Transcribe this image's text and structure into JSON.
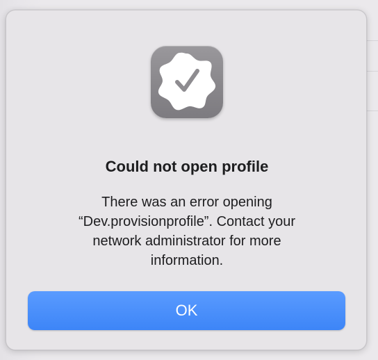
{
  "dialog": {
    "icon": "verified-badge-checkmark-icon",
    "title": "Could not open profile",
    "message": "There was an error opening “Dev.provisionprofile”. Contact your network administrator for more information.",
    "ok_label": "OK"
  },
  "colors": {
    "accent": "#3d85f7",
    "icon_bg": "#8a888c",
    "dialog_bg": "#e7e5e8",
    "text": "#1d1d1f"
  }
}
